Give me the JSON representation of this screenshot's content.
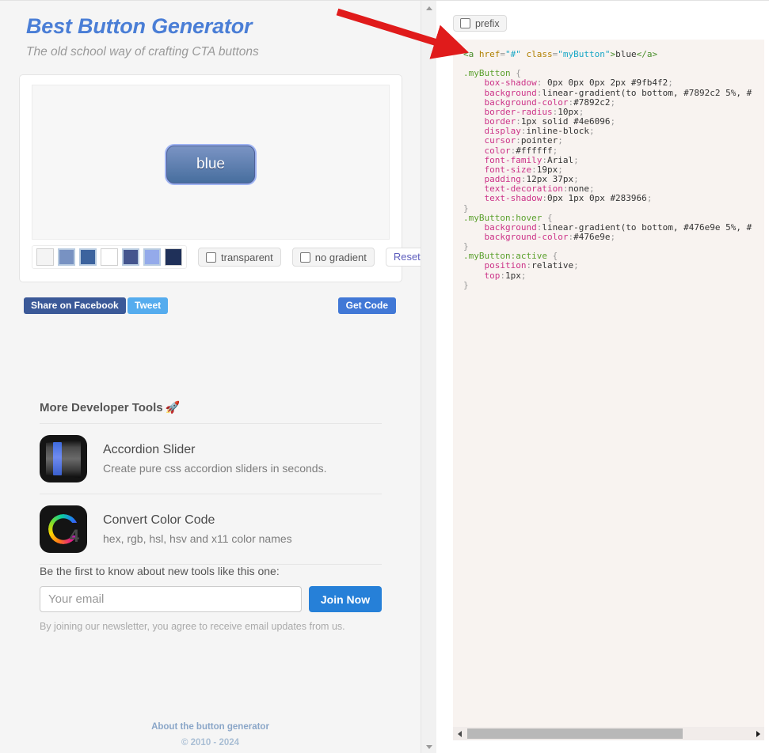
{
  "brand": {
    "title": "Best Button Generator",
    "subtitle": "The old school way of crafting CTA buttons"
  },
  "preview": {
    "button_label": "blue",
    "button_bg_top": "#7892c2",
    "button_bg_bottom": "#476e9e",
    "button_border": "#4e6096",
    "button_glow": "#9fb4f2",
    "button_text_color": "#ffffff"
  },
  "swatches": [
    {
      "name": "swatch-1",
      "color": "#f4f4f4",
      "selected": false
    },
    {
      "name": "swatch-2",
      "color": "#7892c2",
      "selected": true
    },
    {
      "name": "swatch-3",
      "color": "#3c639e",
      "selected": true
    },
    {
      "name": "swatch-4",
      "color": "#ffffff",
      "selected": false
    },
    {
      "name": "swatch-5",
      "color": "#44558e",
      "selected": true
    },
    {
      "name": "swatch-6",
      "color": "#94aaea",
      "selected": true
    },
    {
      "name": "swatch-7",
      "color": "#1f3059",
      "selected": false
    }
  ],
  "controls": {
    "transparent_label": "transparent",
    "transparent_checked": false,
    "no_gradient_label": "no gradient",
    "no_gradient_checked": false,
    "reset_label": "Reset"
  },
  "actions": {
    "facebook_label": "Share on Facebook",
    "tweet_label": "Tweet",
    "get_code_label": "Get Code"
  },
  "tools": {
    "heading": "More Developer Tools",
    "heading_icon": "rocket-icon",
    "rocket_glyph": "🚀",
    "items": [
      {
        "icon": "accordion-slider-icon",
        "title": "Accordion Slider",
        "desc": "Create pure css accordion sliders in seconds."
      },
      {
        "icon": "convert-color-code-icon",
        "title": "Convert Color Code",
        "desc": "hex, rgb, hsl, hsv and x11 color names",
        "icon_text": "4"
      }
    ]
  },
  "newsletter": {
    "label": "Be the first to know about new tools like this one:",
    "email_value": "",
    "email_placeholder": "Your email",
    "join_label": "Join Now",
    "note": "By joining our newsletter, you agree to receive email updates from us."
  },
  "footer": {
    "about_link": "About the button generator",
    "copyright": "© 2010 - 2024"
  },
  "code_panel": {
    "prefix_label": "prefix",
    "prefix_checked": false,
    "lines": [
      {
        "tokens": [
          {
            "t": "<a ",
            "c": "t-tag"
          },
          {
            "t": "href",
            "c": "t-attr"
          },
          {
            "t": "=",
            "c": "t-punc"
          },
          {
            "t": "\"#\"",
            "c": "t-str"
          },
          {
            "t": " ",
            "c": "t-txt"
          },
          {
            "t": "class",
            "c": "t-attr"
          },
          {
            "t": "=",
            "c": "t-punc"
          },
          {
            "t": "\"myButton\"",
            "c": "t-str"
          },
          {
            "t": ">",
            "c": "t-tag"
          },
          {
            "t": "blue",
            "c": "t-txt"
          },
          {
            "t": "</a>",
            "c": "t-tag"
          }
        ]
      },
      {
        "tokens": []
      },
      {
        "tokens": [
          {
            "t": ".myButton",
            "c": "t-sel"
          },
          {
            "t": " {",
            "c": "t-punc"
          }
        ]
      },
      {
        "tokens": [
          {
            "t": "    box-shadow",
            "c": "t-prop"
          },
          {
            "t": ": ",
            "c": "t-punc"
          },
          {
            "t": "0px 0px 0px 2px #9fb4f2",
            "c": "t-val"
          },
          {
            "t": ";",
            "c": "t-punc"
          }
        ]
      },
      {
        "tokens": [
          {
            "t": "    background",
            "c": "t-prop"
          },
          {
            "t": ":",
            "c": "t-punc"
          },
          {
            "t": "linear-gradient(to bottom, #7892c2 5%, #",
            "c": "t-val"
          }
        ]
      },
      {
        "tokens": [
          {
            "t": "    background-color",
            "c": "t-prop"
          },
          {
            "t": ":",
            "c": "t-punc"
          },
          {
            "t": "#7892c2",
            "c": "t-val"
          },
          {
            "t": ";",
            "c": "t-punc"
          }
        ]
      },
      {
        "tokens": [
          {
            "t": "    border-radius",
            "c": "t-prop"
          },
          {
            "t": ":",
            "c": "t-punc"
          },
          {
            "t": "10px",
            "c": "t-val"
          },
          {
            "t": ";",
            "c": "t-punc"
          }
        ]
      },
      {
        "tokens": [
          {
            "t": "    border",
            "c": "t-prop"
          },
          {
            "t": ":",
            "c": "t-punc"
          },
          {
            "t": "1px solid #4e6096",
            "c": "t-val"
          },
          {
            "t": ";",
            "c": "t-punc"
          }
        ]
      },
      {
        "tokens": [
          {
            "t": "    display",
            "c": "t-prop"
          },
          {
            "t": ":",
            "c": "t-punc"
          },
          {
            "t": "inline-block",
            "c": "t-val"
          },
          {
            "t": ";",
            "c": "t-punc"
          }
        ]
      },
      {
        "tokens": [
          {
            "t": "    cursor",
            "c": "t-prop"
          },
          {
            "t": ":",
            "c": "t-punc"
          },
          {
            "t": "pointer",
            "c": "t-val"
          },
          {
            "t": ";",
            "c": "t-punc"
          }
        ]
      },
      {
        "tokens": [
          {
            "t": "    color",
            "c": "t-prop"
          },
          {
            "t": ":",
            "c": "t-punc"
          },
          {
            "t": "#ffffff",
            "c": "t-val"
          },
          {
            "t": ";",
            "c": "t-punc"
          }
        ]
      },
      {
        "tokens": [
          {
            "t": "    font-family",
            "c": "t-prop"
          },
          {
            "t": ":",
            "c": "t-punc"
          },
          {
            "t": "Arial",
            "c": "t-val"
          },
          {
            "t": ";",
            "c": "t-punc"
          }
        ]
      },
      {
        "tokens": [
          {
            "t": "    font-size",
            "c": "t-prop"
          },
          {
            "t": ":",
            "c": "t-punc"
          },
          {
            "t": "19px",
            "c": "t-val"
          },
          {
            "t": ";",
            "c": "t-punc"
          }
        ]
      },
      {
        "tokens": [
          {
            "t": "    padding",
            "c": "t-prop"
          },
          {
            "t": ":",
            "c": "t-punc"
          },
          {
            "t": "12px 37px",
            "c": "t-val"
          },
          {
            "t": ";",
            "c": "t-punc"
          }
        ]
      },
      {
        "tokens": [
          {
            "t": "    text-decoration",
            "c": "t-prop"
          },
          {
            "t": ":",
            "c": "t-punc"
          },
          {
            "t": "none",
            "c": "t-val"
          },
          {
            "t": ";",
            "c": "t-punc"
          }
        ]
      },
      {
        "tokens": [
          {
            "t": "    text-shadow",
            "c": "t-prop"
          },
          {
            "t": ":",
            "c": "t-punc"
          },
          {
            "t": "0px 1px 0px #283966",
            "c": "t-val"
          },
          {
            "t": ";",
            "c": "t-punc"
          }
        ]
      },
      {
        "tokens": [
          {
            "t": "}",
            "c": "t-punc"
          }
        ]
      },
      {
        "tokens": [
          {
            "t": ".myButton:hover",
            "c": "t-sel"
          },
          {
            "t": " {",
            "c": "t-punc"
          }
        ]
      },
      {
        "tokens": [
          {
            "t": "    background",
            "c": "t-prop"
          },
          {
            "t": ":",
            "c": "t-punc"
          },
          {
            "t": "linear-gradient(to bottom, #476e9e 5%, #",
            "c": "t-val"
          }
        ]
      },
      {
        "tokens": [
          {
            "t": "    background-color",
            "c": "t-prop"
          },
          {
            "t": ":",
            "c": "t-punc"
          },
          {
            "t": "#476e9e",
            "c": "t-val"
          },
          {
            "t": ";",
            "c": "t-punc"
          }
        ]
      },
      {
        "tokens": [
          {
            "t": "}",
            "c": "t-punc"
          }
        ]
      },
      {
        "tokens": [
          {
            "t": ".myButton:active",
            "c": "t-sel"
          },
          {
            "t": " {",
            "c": "t-punc"
          }
        ]
      },
      {
        "tokens": [
          {
            "t": "    position",
            "c": "t-prop"
          },
          {
            "t": ":",
            "c": "t-punc"
          },
          {
            "t": "relative",
            "c": "t-val"
          },
          {
            "t": ";",
            "c": "t-punc"
          }
        ]
      },
      {
        "tokens": [
          {
            "t": "    top",
            "c": "t-prop"
          },
          {
            "t": ":",
            "c": "t-punc"
          },
          {
            "t": "1px",
            "c": "t-val"
          },
          {
            "t": ";",
            "c": "t-punc"
          }
        ]
      },
      {
        "tokens": [
          {
            "t": "}",
            "c": "t-punc"
          }
        ]
      }
    ]
  },
  "annotation": {
    "arrow_color": "#e01b1b",
    "arrow_name": "red-pointer-arrow"
  }
}
